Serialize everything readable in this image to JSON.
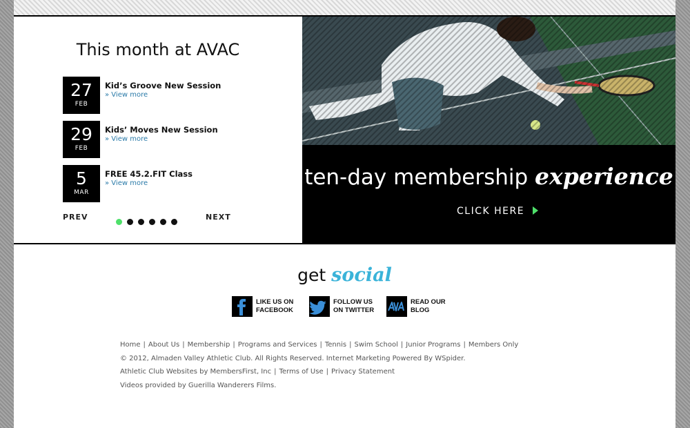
{
  "events": {
    "title": "This month at AVAC",
    "items": [
      {
        "day": "27",
        "month": "FEB",
        "title": "Kid’s Groove New Session",
        "link": "» View more"
      },
      {
        "day": "29",
        "month": "FEB",
        "title": "Kids’ Moves New Session",
        "link": "» View more"
      },
      {
        "day": "5",
        "month": "MAR",
        "title": "FREE 45.2.FIT Class",
        "link": "» View more"
      }
    ],
    "prev": "PREV",
    "next": "NEXT",
    "pager_count": 6,
    "pager_active": 1,
    "accent": "#4ee06a"
  },
  "promo": {
    "tagline_main": "ten-day membership",
    "tagline_script": "experience",
    "cta": "CLICK HERE",
    "cta_arrow_color": "#4ee06a"
  },
  "social": {
    "title_main": "get",
    "title_script": "social",
    "script_color": "#3ab3d9",
    "items": [
      {
        "icon": "facebook-icon",
        "line1": "LIKE US ON",
        "line2": "FACEBOOK"
      },
      {
        "icon": "twitter-icon",
        "line1": "FOLLOW US",
        "line2": "ON TWITTER"
      },
      {
        "icon": "blog-icon",
        "line1": "READ OUR",
        "line2": "BLOG"
      }
    ]
  },
  "footer": {
    "nav": [
      "Home",
      "About Us",
      "Membership",
      "Programs and Services",
      "Tennis",
      "Swim School",
      "Junior Programs",
      "Members Only"
    ],
    "copyright": "© 2012, Almaden Valley Athletic Club. All Rights Reserved. Internet Marketing Powered By WSpider.",
    "credits": [
      "Athletic Club Websites by MembersFirst, Inc",
      "Terms of Use",
      "Privacy Statement"
    ],
    "videos": "Videos provided by Guerilla Wanderers Films."
  }
}
